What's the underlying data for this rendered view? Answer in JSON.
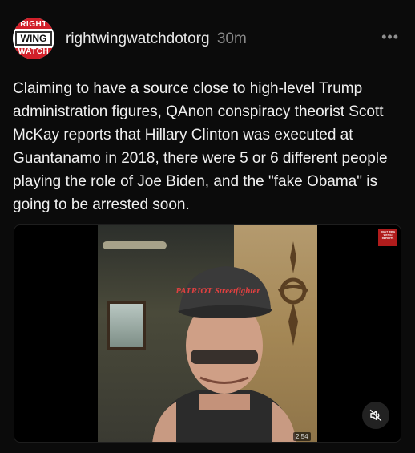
{
  "post": {
    "avatar": {
      "top_text": "RIGHT",
      "middle_text": "WING",
      "bottom_text": "WATCH",
      "colors": {
        "band": "#d2202a",
        "background": "#ffffff"
      }
    },
    "username": "rightwingwatchdotorg",
    "time": "30m",
    "more_icon": "more-horizontal-icon",
    "text": "Claiming to have a source close to high-level Trump administration figures, QAnon conspiracy theorist Scott McKay reports that Hillary Clinton was executed at Guantanamo in 2018, there were 5 or 6 different people playing the role of Joe Biden, and the \"fake Obama\" is going to be arrested soon.",
    "video": {
      "duration": "2:54",
      "watermark": "RIGHT WING WATCH REPORTS",
      "cap_text": "PATRIOT Streetfighter",
      "mute_icon": "speaker-muted-icon"
    }
  }
}
